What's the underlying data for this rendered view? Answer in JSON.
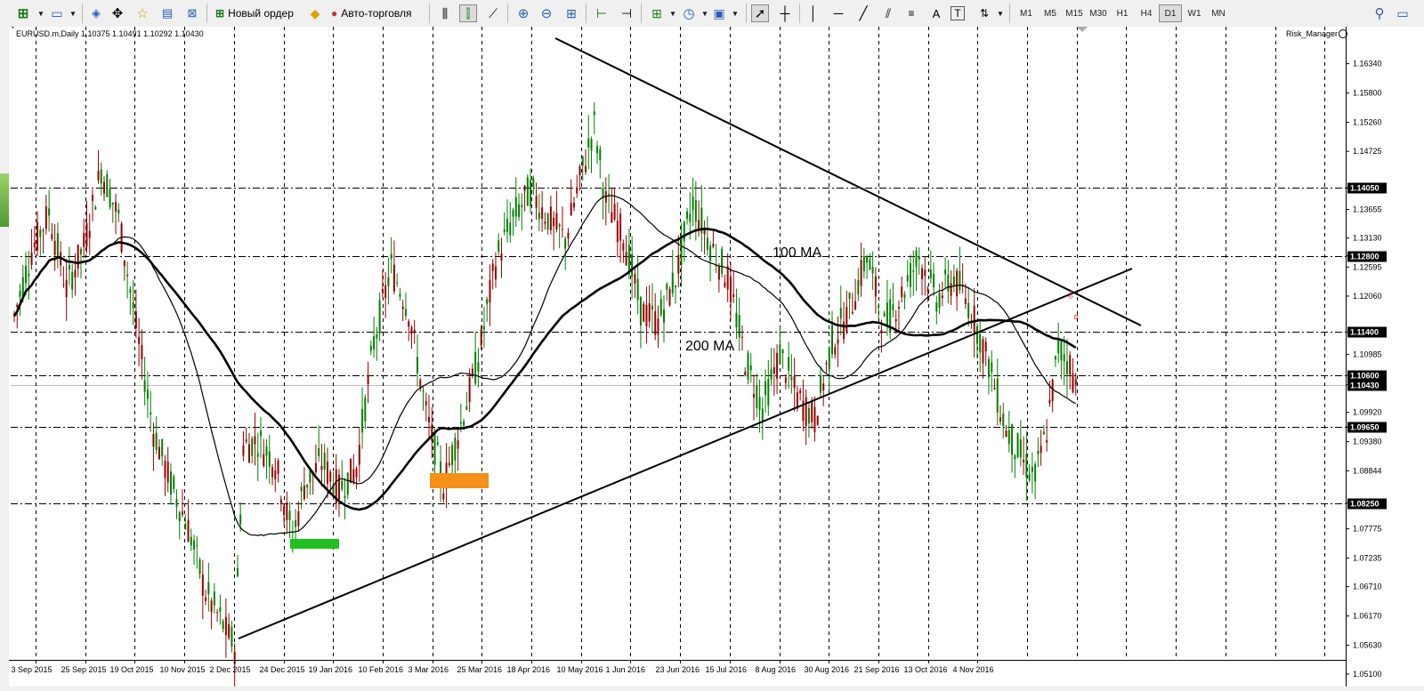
{
  "toolbar": {
    "new_order_label": "Новый ордер",
    "autotrading_label": "Авто-торговля",
    "timeframes": [
      "M1",
      "M5",
      "M15",
      "M30",
      "H1",
      "H4",
      "D1",
      "W1",
      "MN"
    ],
    "active_timeframe": "D1"
  },
  "chart": {
    "header": "EURUSD.m,Daily  1.10375 1.10491 1.10292 1.10430",
    "indicator": "Risk_Manager",
    "label_100ma": "100 MA",
    "label_200ma": "200 MA"
  },
  "chart_data": {
    "type": "candlestick",
    "symbol": "EURUSD.m",
    "timeframe": "Daily",
    "ohlc_last": {
      "open": 1.10375,
      "high": 1.10491,
      "low": 1.10292,
      "close": 1.1043
    },
    "y_ticks": [
      "1.16340",
      "1.15800",
      "1.15260",
      "1.14725",
      "1.14050",
      "1.13655",
      "1.13130",
      "1.12800",
      "1.12595",
      "1.12060",
      "1.11400",
      "1.10985",
      "1.10600",
      "1.10430",
      "1.09920",
      "1.09650",
      "1.09380",
      "1.08844",
      "1.08250",
      "1.07775",
      "1.07235",
      "1.06710",
      "1.06170",
      "1.05630",
      "1.05100"
    ],
    "x_ticks": [
      "3 Sep 2015",
      "25 Sep 2015",
      "19 Oct 2015",
      "10 Nov 2015",
      "2 Dec 2015",
      "24 Dec 2015",
      "19 Jan 2016",
      "10 Feb 2016",
      "3 Mar 2016",
      "25 Mar 2016",
      "18 Apr 2016",
      "10 May 2016",
      "1 Jun 2016",
      "23 Jun 2016",
      "15 Jul 2016",
      "8 Aug 2016",
      "30 Aug 2016",
      "21 Sep 2016",
      "13 Oct 2016",
      "4 Nov 2016"
    ],
    "price_lines": [
      {
        "price": "1.14050"
      },
      {
        "price": "1.12800"
      },
      {
        "price": "1.11400"
      },
      {
        "price": "1.10600"
      },
      {
        "price": "1.10430",
        "current": true
      },
      {
        "price": "1.09650"
      },
      {
        "price": "1.08250"
      }
    ],
    "ylim": [
      1.051,
      1.166
    ],
    "ma_series": [
      "100 MA",
      "200 MA"
    ]
  },
  "colors": {
    "bull": "#008000",
    "bear": "#990000",
    "grid": "#000000",
    "green_marker": "#21c020",
    "orange_marker": "#f59018",
    "arrow": "#ff3030"
  }
}
